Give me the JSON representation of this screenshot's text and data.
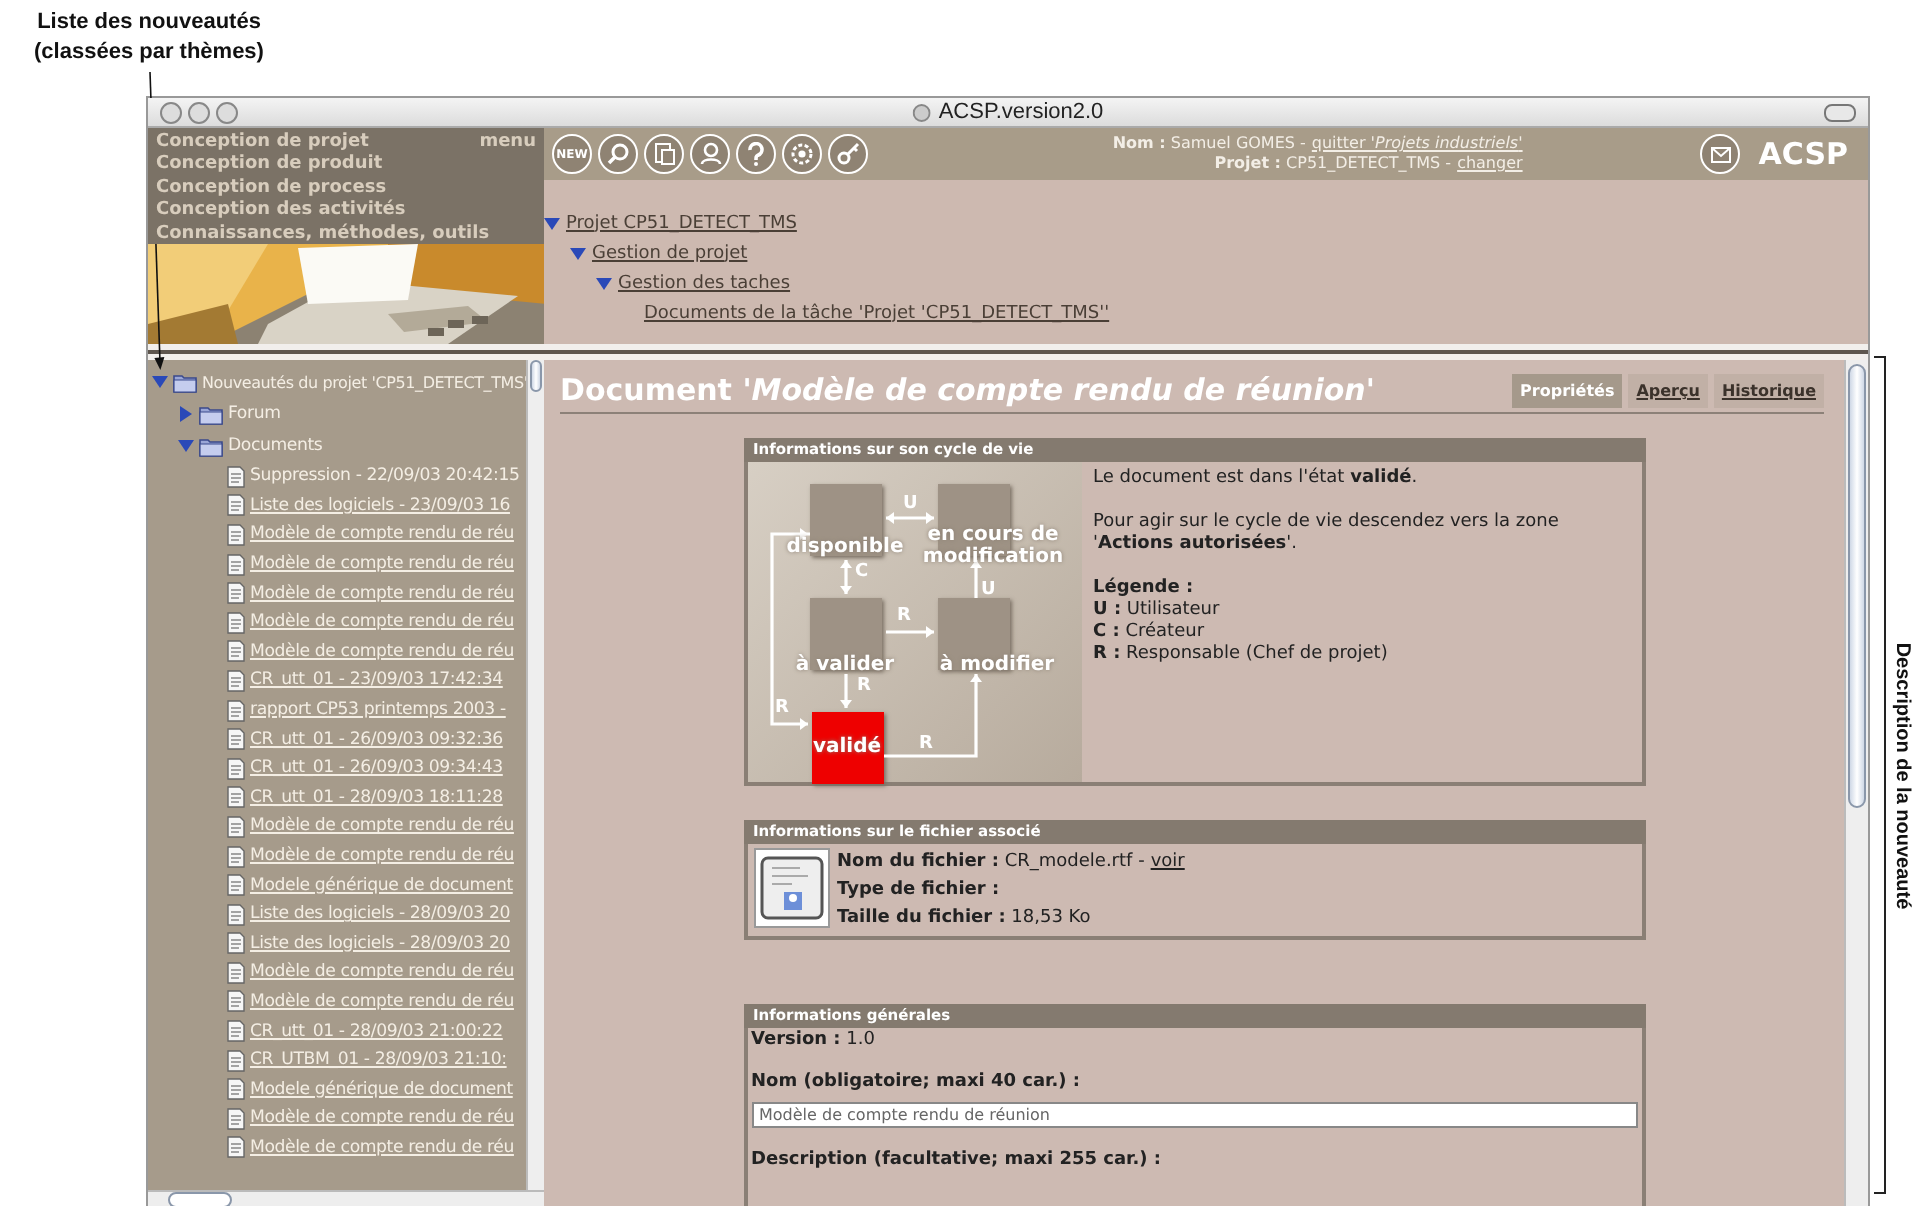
{
  "annotations": {
    "top_left": [
      "Liste des nouveautés",
      "(classées par thèmes)"
    ],
    "right": "Description de la nouveauté"
  },
  "window": {
    "title": "ACSP.version2.0"
  },
  "menu": {
    "label": "menu",
    "items": [
      "Conception de projet",
      "Conception de produit",
      "Conception de process",
      "Conception des activités",
      "Connaissances, méthodes, outils"
    ]
  },
  "toolbar": {
    "new_label": "NEW"
  },
  "user": {
    "name_label": "Nom :",
    "name": "Samuel GOMES -",
    "quit_link": "quitter '*Projets industriels*'",
    "project_label": "Projet :",
    "project": "CP51_DETECT_TMS -",
    "change_link": "changer"
  },
  "brand": "ACSP",
  "breadcrumb": [
    {
      "label": "Projet CP51_DETECT_TMS",
      "expanded": true,
      "children": [
        {
          "label": "Gestion de projet",
          "expanded": true,
          "children": [
            {
              "label": "Gestion des taches",
              "expanded": true,
              "children": [
                {
                  "label": "Documents de la tâche 'Projet 'CP51_DETECT_TMS''"
                }
              ]
            }
          ]
        }
      ]
    }
  ],
  "tree": [
    {
      "label": "Nouveautés du projet 'CP51_DETECT_TMS'",
      "kind": "folder",
      "expanded": true,
      "children": [
        {
          "label": "Forum",
          "kind": "folder",
          "expanded": false
        },
        {
          "label": "Documents",
          "kind": "folder",
          "expanded": true,
          "children": [
            {
              "label": "Suppression - 22/09/03 20:42:15",
              "kind": "document",
              "linked": false
            },
            {
              "label": "Liste des logiciels - 23/09/03 16",
              "kind": "document",
              "linked": true
            },
            {
              "label": "Modèle de compte rendu de réu",
              "kind": "document",
              "linked": true
            },
            {
              "label": "Modèle de compte rendu de réu",
              "kind": "document",
              "linked": true
            },
            {
              "label": "Modèle de compte rendu de réu",
              "kind": "document",
              "linked": true
            },
            {
              "label": "Modèle de compte rendu de réu",
              "kind": "document",
              "linked": true
            },
            {
              "label": "Modèle de compte rendu de réu",
              "kind": "document",
              "linked": true
            },
            {
              "label": "CR_utt_01 - 23/09/03 17:42:34",
              "kind": "document",
              "linked": true
            },
            {
              "label": "rapport CP53 printemps 2003 -",
              "kind": "document",
              "linked": true
            },
            {
              "label": "CR_utt_01 - 26/09/03 09:32:36",
              "kind": "document",
              "linked": true
            },
            {
              "label": "CR_utt_01 - 26/09/03 09:34:43",
              "kind": "document",
              "linked": true
            },
            {
              "label": "CR_utt_01 - 28/09/03 18:11:28",
              "kind": "document",
              "linked": true
            },
            {
              "label": "Modèle de compte rendu de réu",
              "kind": "document",
              "linked": true
            },
            {
              "label": "Modèle de compte rendu de réu",
              "kind": "document",
              "linked": true
            },
            {
              "label": "Modele générique de document",
              "kind": "document",
              "linked": true
            },
            {
              "label": "Liste des logiciels - 28/09/03 20",
              "kind": "document",
              "linked": true
            },
            {
              "label": "Liste des logiciels - 28/09/03 20",
              "kind": "document",
              "linked": true
            },
            {
              "label": "Modèle de compte rendu de réu",
              "kind": "document",
              "linked": true
            },
            {
              "label": "Modèle de compte rendu de réu",
              "kind": "document",
              "linked": true
            },
            {
              "label": "CR_utt_01 - 28/09/03 21:00:22",
              "kind": "document",
              "linked": true
            },
            {
              "label": "CR_UTBM_01 - 28/09/03 21:10:",
              "kind": "document",
              "linked": true
            },
            {
              "label": "Modele générique de document",
              "kind": "document",
              "linked": true
            },
            {
              "label": "Modèle de compte rendu de réu",
              "kind": "document",
              "linked": true
            },
            {
              "label": "Modèle de compte rendu de réu",
              "kind": "document",
              "linked": true
            }
          ]
        }
      ]
    }
  ],
  "document": {
    "title": "Document '*Modèle de compte rendu de réunion*'"
  },
  "tabs": [
    {
      "label": "Propriétés",
      "selected": true
    },
    {
      "label": "Aperçu",
      "selected": false
    },
    {
      "label": "Historique",
      "selected": false
    }
  ],
  "lifecycle": {
    "title": "Informations sur son cycle de vie",
    "states": [
      {
        "label": "disponible",
        "current": false
      },
      {
        "label": "en cours de modification",
        "current": false
      },
      {
        "label": "à valider",
        "current": false
      },
      {
        "label": "à modifier",
        "current": false
      },
      {
        "label": "validé",
        "current": true
      }
    ],
    "arrows": [
      {
        "label": "U"
      },
      {
        "label": "C"
      },
      {
        "label": "U"
      },
      {
        "label": "R"
      },
      {
        "label": "R"
      },
      {
        "label": "R"
      },
      {
        "label": "R"
      }
    ],
    "status": "Le document est dans l'état **validé**.",
    "hint": "Pour agir sur le cycle de vie descendez vers la zone '**Actions autorisées**'.",
    "legend_title": "Légende :",
    "legend": [
      {
        "key": "U :",
        "value": "Utilisateur"
      },
      {
        "key": "C :",
        "value": "Créateur"
      },
      {
        "key": "R :",
        "value": "Responsable (Chef de projet)"
      }
    ]
  },
  "file_info": {
    "title": "Informations sur le fichier associé",
    "rows": [
      {
        "label": "Nom du fichier :",
        "value": "CR_modele.rtf -",
        "link": "voir"
      },
      {
        "label": "Type de fichier :"
      },
      {
        "label": "Taille du fichier :",
        "value": "18,53 Ko"
      }
    ]
  },
  "general": {
    "title": "Informations générales",
    "version_label": "Version :",
    "version": "1.0",
    "name_label": "Nom (obligatoire; maxi 40 car.) :",
    "name_value": "Modèle de compte rendu de réunion",
    "description_label": "Description (facultative; maxi 255 car.) :"
  }
}
